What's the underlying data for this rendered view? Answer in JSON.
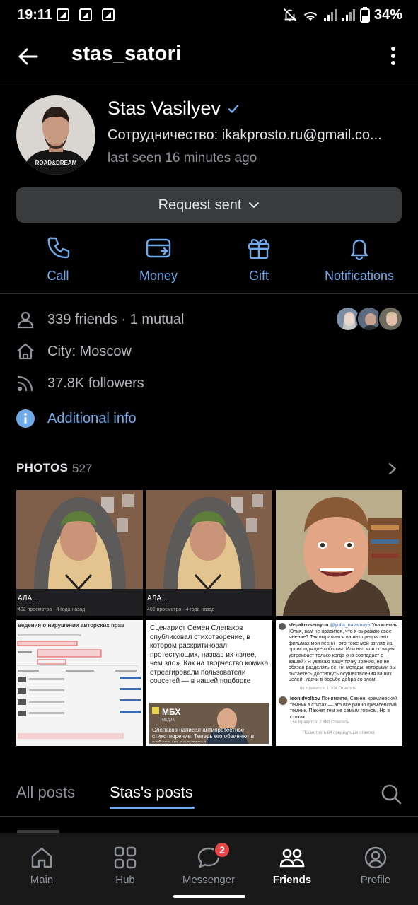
{
  "status_bar": {
    "time": "19:11",
    "battery": "34%"
  },
  "header": {
    "username": "stas_satori"
  },
  "profile": {
    "name": "Stas Vasilyev",
    "status": "Сотрудничество: ikakprosto.ru@gmail.co...",
    "last_seen": "last seen 16 minutes ago",
    "avatar_text": "ROAD&DREAM",
    "verified": true
  },
  "request_button": {
    "label": "Request sent"
  },
  "actions": [
    {
      "label": "Call",
      "icon": "phone-icon"
    },
    {
      "label": "Money",
      "icon": "money-icon"
    },
    {
      "label": "Gift",
      "icon": "gift-icon"
    },
    {
      "label": "Notifications",
      "icon": "bell-icon"
    }
  ],
  "info": {
    "friends": "339 friends · 1 mutual",
    "city": "City: Moscow",
    "followers": "37.8K followers",
    "additional": "Additional info"
  },
  "photos": {
    "title": "PHOTOS",
    "count": "527",
    "items": [
      {
        "caption": "АЛА...",
        "sub": "402 просмотра · 4 года назад"
      },
      {
        "caption": "АЛА...",
        "sub": "402 просмотра · 4 года назад"
      },
      {
        "caption": "",
        "sub": ""
      },
      {
        "heading": "ведения о нарушении авторских прав"
      },
      {
        "text": "Сценарист Семен Слепаков опубликовал стихотворение, в котором раскритиковал протестующих, назвав их «злее, чем зло». Как на творчество комика отреагировали пользователи соцсетей — в нашей подборке",
        "logo": "МБХ",
        "logo_sub": "МЕДИА",
        "bottom": "Слепаков написал антипротестное стихотворение. Теперь его обвиняют в работе на депутатов"
      },
      {
        "user1": "slepakovsemyon",
        "mention": "@yulia_navalnaya",
        "text1": "Уважаемая Юлия, вам не нравится, что я выражаю свое мнение? Так выражаю я ваших прекрасных фильмах мои песни - это тоже мой взгляд на происходящие события. Или вас моя позиция устраивает только когда она совпадает с вашей? Я уважаю вашу точку зрения, но не обязан разделять ее, ни методы, которыми вы пытаетесь достигнуть осуществления ваших целей. Удачи в борьбе добра со злом!",
        "meta1": "6ч   Нравится: 1 304   Ответить",
        "user2": "leonidvolkov",
        "text2": "Понимаете, Семен: кремлевский темник в стихах — это все равно кремлевский темник. Пахнет тем же самым говном. Но в стихах.",
        "meta2": "15ч   Нравится: 2 868   Ответить",
        "more": "Посмотреть 84 предыдущих ответов"
      }
    ]
  },
  "tabs": {
    "all": "All posts",
    "own": "Stas's posts"
  },
  "nav": [
    {
      "label": "Main",
      "icon": "home-icon"
    },
    {
      "label": "Hub",
      "icon": "grid-icon"
    },
    {
      "label": "Messenger",
      "icon": "chat-icon",
      "badge": "2"
    },
    {
      "label": "Friends",
      "icon": "friends-icon",
      "active": true
    },
    {
      "label": "Profile",
      "icon": "profile-icon"
    }
  ],
  "colors": {
    "accent": "#71aaeb",
    "background": "#000000",
    "badge": "#e64646"
  }
}
